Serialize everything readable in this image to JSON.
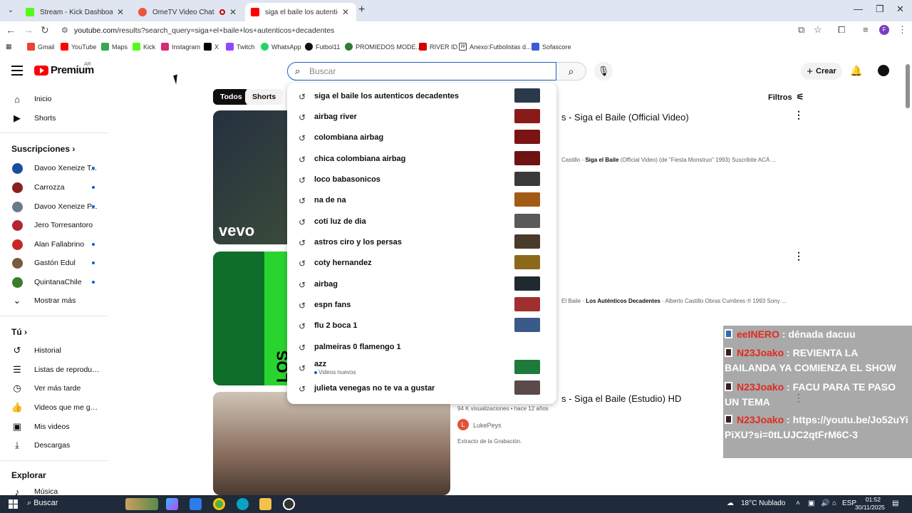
{
  "browser": {
    "tabs": [
      {
        "title": "Stream - Kick Dashboard",
        "color": "#53fc18"
      },
      {
        "title": "OmeTV Video Chat - Ome",
        "color": "#e8583a"
      },
      {
        "title": "siga el baile los autenticos deca",
        "color": "#ff0000"
      }
    ],
    "url_site": "youtube.com",
    "url_path": "/results?search_query=siga+el+baile+los+autenticos+decadentes",
    "bookmarks": [
      {
        "label": "Gmail",
        "color": "#ea4335"
      },
      {
        "label": "YouTube",
        "color": "#ff0000"
      },
      {
        "label": "Maps",
        "color": "#34a853"
      },
      {
        "label": "Kick",
        "color": "#53fc18"
      },
      {
        "label": "Instagram",
        "color": "#d62976"
      },
      {
        "label": "X",
        "color": "#000000"
      },
      {
        "label": "Twitch",
        "color": "#9146ff"
      },
      {
        "label": "WhatsApp",
        "color": "#25d366"
      },
      {
        "label": "Futbol11",
        "color": "#111111"
      },
      {
        "label": "PROMIEDOS MODE...",
        "color": "#2e7d32"
      },
      {
        "label": "RIVER ID",
        "color": "#d50000"
      },
      {
        "label": "Anexo:Futbolistas d...",
        "color": "#444444"
      },
      {
        "label": "Sofascore",
        "color": "#3a5bd9"
      }
    ],
    "profile_letter": "F"
  },
  "header": {
    "logo": "Premium",
    "country": "AR",
    "search_placeholder": "Buscar",
    "create_label": "Crear"
  },
  "sidebar": {
    "main": [
      "Inicio",
      "Shorts"
    ],
    "subs_title": "Suscripciones",
    "subs": [
      {
        "name": "Davoo Xeneize T...",
        "color": "#1a4d9c"
      },
      {
        "name": "Carrozza",
        "color": "#8a1f1f"
      },
      {
        "name": "Davoo Xeneize P...",
        "color": "#6b7a8a"
      },
      {
        "name": "Jero Torresantoro",
        "color": "#b3262e"
      },
      {
        "name": "Alan Fallabrino",
        "color": "#c62828"
      },
      {
        "name": "Gastón Edul",
        "color": "#7a5a3c"
      },
      {
        "name": "QuintanaChile",
        "color": "#3a7d2a"
      }
    ],
    "show_more": "Mostrar más",
    "you_title": "Tú",
    "you_items": [
      "Historial",
      "Listas de reproducc...",
      "Ver más tarde",
      "Videos que me gus...",
      "Mis videos",
      "Descargas"
    ],
    "explore_title": "Explorar",
    "explore_items": [
      "Música"
    ]
  },
  "chips": [
    "Todos",
    "Shorts"
  ],
  "filters_label": "Filtros",
  "results": [
    {
      "title": "s - Siga el Baile (Official Video)",
      "desc_pre": "Castillo - ",
      "desc_bold": "Siga el Baile",
      "desc_post": " (Official Video) (de \"Fiesta Monstruo\" 1993) Suscribite ACÁ ...",
      "watermark": "vevo"
    },
    {
      "title": "",
      "desc_pre": "El Baile · ",
      "desc_bold": "Los Auténticos Decadentes",
      "desc_post": " · Alberto Castillo Obras Cumbres ℗ 1993 Sony ...",
      "cover_text": "LOS AUTÉNTICOS"
    },
    {
      "title": "s - Siga el Baile (Estudio) HD",
      "meta": "94 K visualizaciones • hace 12 años",
      "channel": "LukePeys",
      "channel_initial": "L",
      "desc": "Extracto de la Grabación."
    }
  ],
  "suggestions": [
    {
      "text": "siga el baile los autenticos decadentes",
      "thumb": "#2b3a4a"
    },
    {
      "text": "airbag river",
      "thumb": "#8a1a1a"
    },
    {
      "text": "colombiana airbag",
      "thumb": "#7a1414"
    },
    {
      "text": "chica colombiana airbag",
      "thumb": "#6e1212"
    },
    {
      "text": "loco babasonicos",
      "thumb": "#3a3a3a"
    },
    {
      "text": "na de na",
      "thumb": "#a35a14"
    },
    {
      "text": "coti luz de dia",
      "thumb": "#5a5a5a"
    },
    {
      "text": "astros ciro y los persas",
      "thumb": "#4a3a2a"
    },
    {
      "text": "coty hernandez",
      "thumb": "#8a6a1a"
    },
    {
      "text": "airbag",
      "thumb": "#1e2a30"
    },
    {
      "text": "espn fans",
      "thumb": "#a03030"
    },
    {
      "text": "flu 2 boca 1",
      "thumb": "#3a5a8a"
    },
    {
      "text": "palmeiras 0 flamengo 1",
      "thumb": ""
    },
    {
      "text": "azz",
      "sub": "Videos nuevos",
      "thumb": "#1e7a3a"
    },
    {
      "text": "julieta venegas no te va a gustar",
      "thumb": "#5a4a4a"
    }
  ],
  "chat": [
    {
      "user": "eeINERO",
      "msg": " : dénada dacuu"
    },
    {
      "user": "N23Joako",
      "msg": " : REVIENTA LA BAILANDA YA COMIENZA EL SHOW"
    },
    {
      "user": "N23Joako",
      "msg": " : FACU PARA TE PASO UN TEMA"
    },
    {
      "user": "N23Joako",
      "msg": " : https://youtu.be/Jo52uYiPiXU?si=0tLUJC2qtFrM6C-3"
    }
  ],
  "taskbar": {
    "search": "Buscar",
    "weather": "18°C  Nublado",
    "lang": "ESP",
    "time": "01:52",
    "date": "30/11/2025"
  }
}
